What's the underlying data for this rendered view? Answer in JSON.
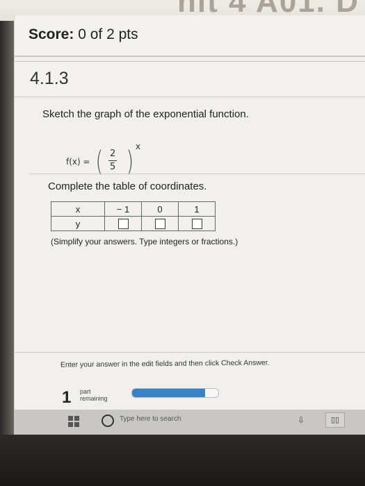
{
  "header": {
    "cut_title": "nit 4 A01. D"
  },
  "score": {
    "label": "Score:",
    "value": "0 of 2 pts"
  },
  "question": {
    "id": "4.1.3",
    "instruction": "Sketch the graph of the exponential function.",
    "function": {
      "lhs": "f(x) =",
      "numerator": "2",
      "denominator": "5",
      "exponent": "x"
    }
  },
  "table_section": {
    "title": "Complete the table of coordinates.",
    "row_x_label": "x",
    "row_y_label": "y",
    "x_values": [
      "− 1",
      "0",
      "1"
    ],
    "y_values": [
      "",
      "",
      ""
    ],
    "hint": "(Simplify your answers. Type integers or fractions.)"
  },
  "footer": {
    "enter_message": "Enter your answer in the edit fields and then click Check Answer.",
    "parts_count": "1",
    "parts_label_line1": "part",
    "parts_label_line2": "remaining",
    "progress_fraction": 0.85
  },
  "taskbar": {
    "search_placeholder": "Type here to search",
    "icons": [
      "windows-logo-icon",
      "cortana-circle-icon",
      "tray-icon",
      "task-view-icon"
    ]
  },
  "colors": {
    "progress": "#3b82c4",
    "background": "#f2f0ec",
    "taskbar": "#c9c7c3"
  }
}
